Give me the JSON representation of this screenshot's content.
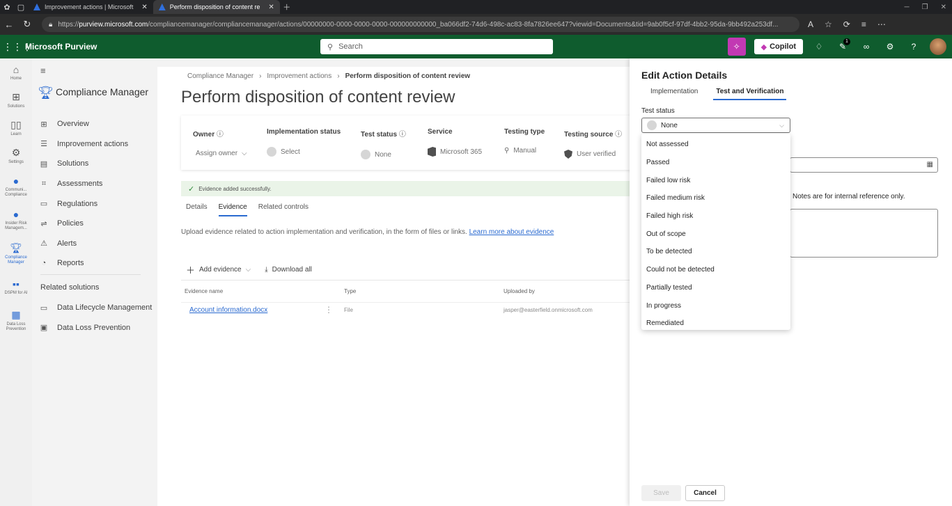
{
  "browser": {
    "tabs": [
      {
        "title": "Improvement actions | Microsoft"
      },
      {
        "title": "Perform disposition of content re"
      }
    ],
    "url_prefix": "https://",
    "url_host": "purview.microsoft.com",
    "url_path": "/compliancemanager/compliancemanager/actions/00000000-0000-0000-0000-000000000000_ba066df2-74d6-498c-ac83-8fa7826ee647?viewid=Documents&tid=9ab0f5cf-97df-4bb2-95da-9bb492a253df..."
  },
  "appbar": {
    "brand": "Microsoft Purview",
    "search_placeholder": "Search",
    "copilot_label": "Copilot",
    "notification_count": "1"
  },
  "rail": {
    "items": [
      {
        "label": "Home",
        "icon": "home-icon"
      },
      {
        "label": "Solutions",
        "icon": "grid-icon"
      },
      {
        "label": "Learn",
        "icon": "book-icon"
      },
      {
        "label": "Settings",
        "icon": "gear-icon"
      },
      {
        "label": "Communi... Compliance",
        "icon": "chat-icon"
      },
      {
        "label": "Insider Risk Managem...",
        "icon": "person-icon"
      },
      {
        "label": "Compliance Manager",
        "icon": "trophy-icon"
      },
      {
        "label": "DSPM for AI",
        "icon": "dspm-icon"
      },
      {
        "label": "Data Loss Prevention",
        "icon": "dlp-icon"
      }
    ]
  },
  "nav": {
    "title": "Compliance Manager",
    "items": [
      {
        "label": "Overview"
      },
      {
        "label": "Improvement actions"
      },
      {
        "label": "Solutions"
      },
      {
        "label": "Assessments"
      },
      {
        "label": "Regulations"
      },
      {
        "label": "Policies"
      },
      {
        "label": "Alerts"
      },
      {
        "label": "Reports"
      }
    ],
    "related_heading": "Related solutions",
    "related": [
      {
        "label": "Data Lifecycle Management"
      },
      {
        "label": "Data Loss Prevention"
      }
    ]
  },
  "main": {
    "breadcrumb": [
      "Compliance Manager",
      "Improvement actions",
      "Perform disposition of content review"
    ],
    "title": "Perform disposition of content review",
    "summary": {
      "owner_h": "Owner",
      "owner_v": "Assign owner",
      "impl_h": "Implementation status",
      "impl_v": "Select",
      "test_h": "Test status",
      "test_v": "None",
      "service_h": "Service",
      "service_v": "Microsoft 365",
      "type_h": "Testing type",
      "type_v": "Manual",
      "source_h": "Testing source",
      "source_v": "User verified"
    },
    "success_msg": "Evidence added successfully.",
    "tabs": [
      "Details",
      "Evidence",
      "Related controls"
    ],
    "upload_text": "Upload evidence related to action implementation and verification, in the form of files or links.",
    "upload_link": "Learn more about evidence",
    "add_evidence": "Add evidence",
    "download_all": "Download all",
    "columns": [
      "Evidence name",
      "Type",
      "Uploaded by"
    ],
    "rows": [
      {
        "name": "Account information.docx",
        "type": "File",
        "uploaded_by": "jasper@easterfield.onmicrosoft.com"
      }
    ]
  },
  "panel": {
    "title": "Edit Action Details",
    "tabs": [
      "Implementation",
      "Test and Verification"
    ],
    "test_status_label": "Test status",
    "test_status_value": "None",
    "options": [
      "Not assessed",
      "Passed",
      "Failed low risk",
      "Failed medium risk",
      "Failed high risk",
      "Out of scope",
      "To be detected",
      "Could not be detected",
      "Partially tested",
      "In progress",
      "Remediated"
    ],
    "notes_hint": "Notes are for internal reference only.",
    "save": "Save",
    "cancel": "Cancel"
  }
}
